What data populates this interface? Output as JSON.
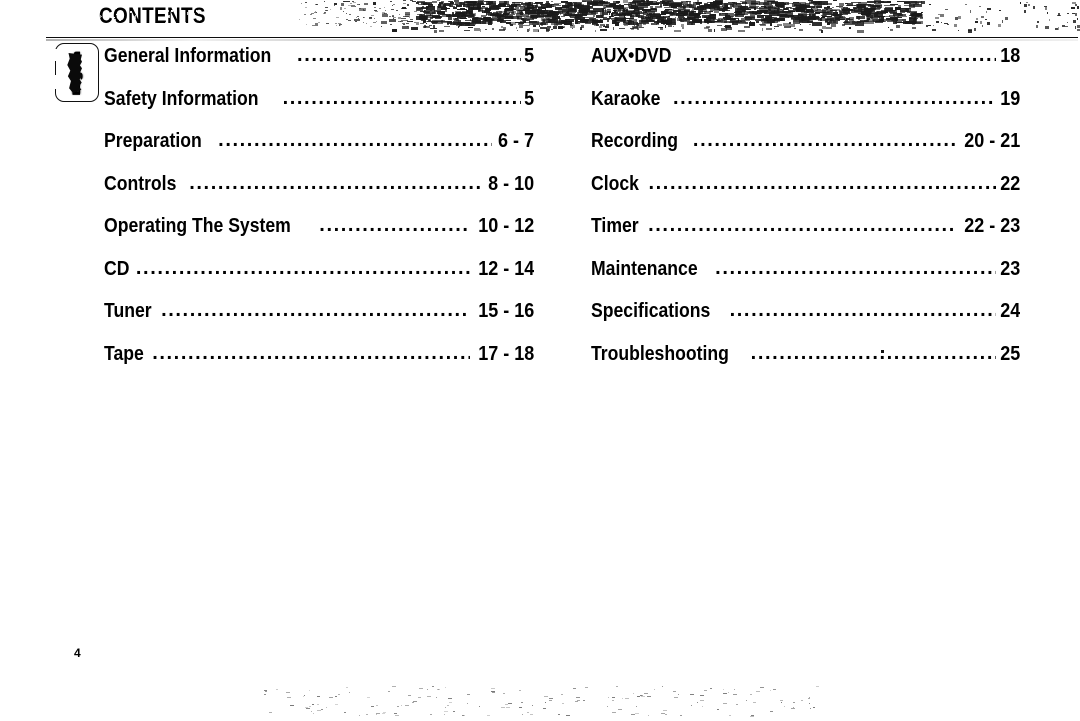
{
  "page": {
    "title": "CONTENTS",
    "page_number": "4",
    "language_tab": "English",
    "background_color": "#ffffff",
    "text_color": "#000000"
  },
  "toc": {
    "left_column": [
      {
        "label": "General Information",
        "pages": "5"
      },
      {
        "label": "Safety Information",
        "pages": "5"
      },
      {
        "label": "Preparation",
        "pages": "6 - 7"
      },
      {
        "label": "Controls",
        "pages": "8 - 10"
      },
      {
        "label": "Operating The System",
        "pages": "10 - 12"
      },
      {
        "label": "CD",
        "pages": "12 - 14"
      },
      {
        "label": "Tuner",
        "pages": "15 - 16"
      },
      {
        "label": "Tape",
        "pages": "17 - 18"
      }
    ],
    "right_column": [
      {
        "label": "AUX•DVD",
        "pages": "18"
      },
      {
        "label": "Karaoke",
        "pages": "19"
      },
      {
        "label": "Recording",
        "pages": "20 - 21"
      },
      {
        "label": "Clock",
        "pages": "22"
      },
      {
        "label": "Timer",
        "pages": "22 - 23"
      },
      {
        "label": "Maintenance",
        "pages": "23"
      },
      {
        "label": "Specifications",
        "pages": "24"
      },
      {
        "label": "Troubleshooting",
        "pages": "25"
      }
    ],
    "leader": "......................................................................................"
  }
}
